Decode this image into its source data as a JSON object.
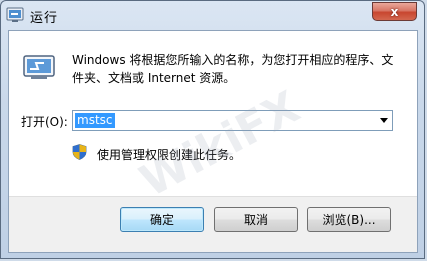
{
  "window": {
    "title": "运行",
    "close_glyph": "x"
  },
  "dialog": {
    "description": "Windows 将根据您所输入的名称，为您打开相应的程序、文件夹、文档或 Internet 资源。",
    "open_label": "打开(O):",
    "command_value": "mstsc",
    "admin_note": "使用管理权限创建此任务。"
  },
  "buttons": {
    "ok": "确定",
    "cancel": "取消",
    "browse": "浏览(B)..."
  },
  "watermark": "WikiFX",
  "icons": {
    "title": "run-app-icon",
    "main": "run-window-icon",
    "admin": "uac-shield-icon"
  },
  "colors": {
    "selection": "#3399ff",
    "close_button": "#c8462f"
  }
}
